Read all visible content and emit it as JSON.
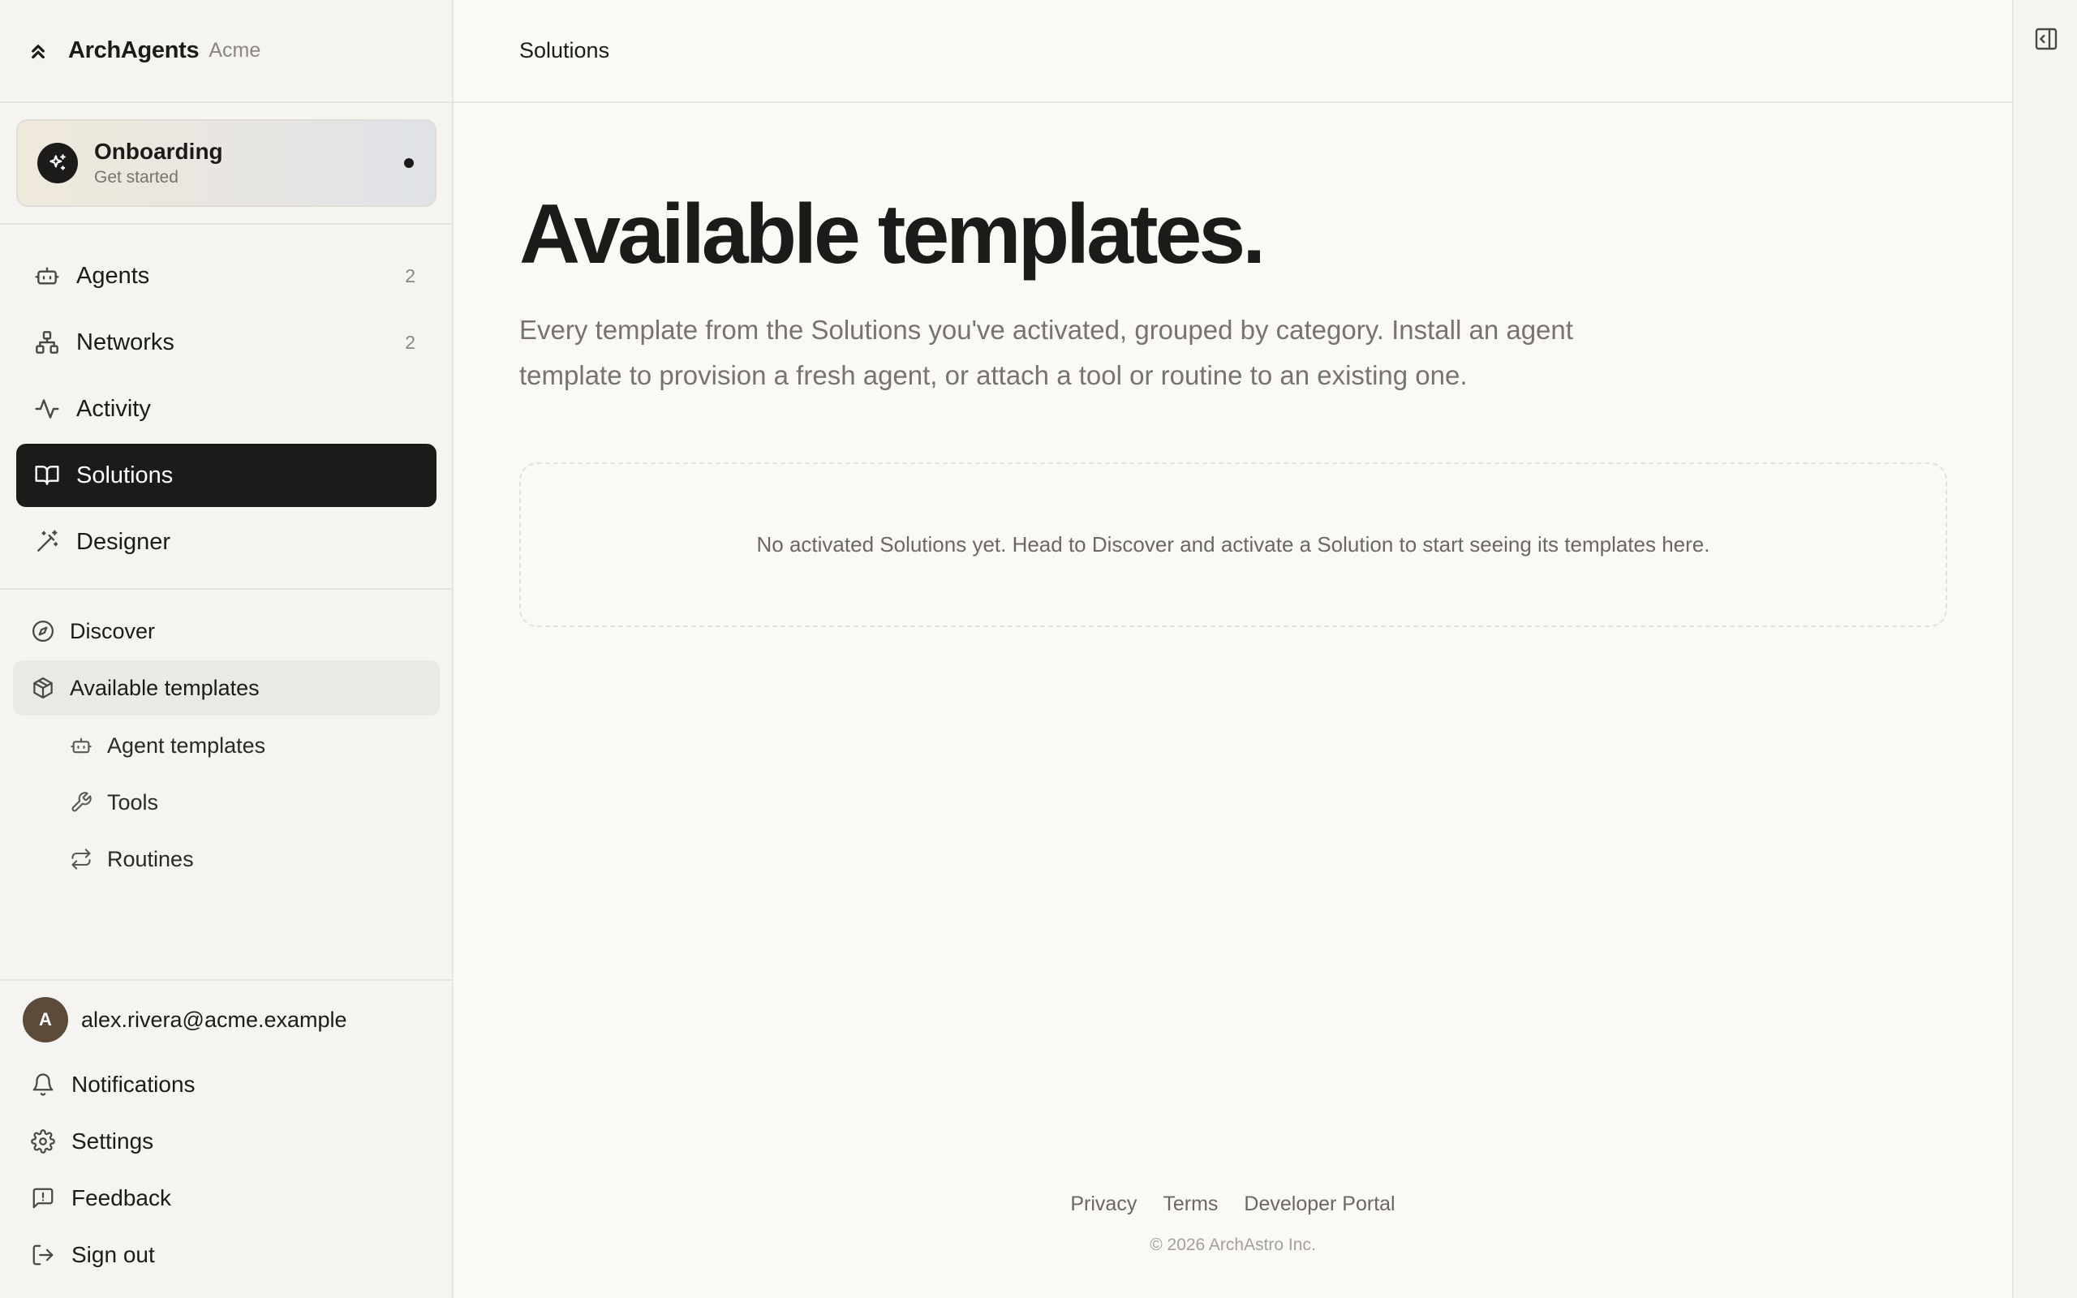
{
  "brand": {
    "name": "ArchAgents",
    "org": "Acme"
  },
  "onboarding": {
    "title": "Onboarding",
    "subtitle": "Get started"
  },
  "nav": {
    "agents": {
      "label": "Agents",
      "count": "2"
    },
    "networks": {
      "label": "Networks",
      "count": "2"
    },
    "activity": {
      "label": "Activity"
    },
    "solutions": {
      "label": "Solutions"
    },
    "designer": {
      "label": "Designer"
    }
  },
  "solutions_nav": {
    "discover": "Discover",
    "available_templates": "Available templates",
    "agent_templates": "Agent templates",
    "tools": "Tools",
    "routines": "Routines"
  },
  "user": {
    "avatar_letter": "A",
    "email": "alex.rivera@acme.example"
  },
  "footer_nav": {
    "notifications": "Notifications",
    "settings": "Settings",
    "feedback": "Feedback",
    "sign_out": "Sign out"
  },
  "header": {
    "breadcrumb": "Solutions"
  },
  "main": {
    "title": "Available templates.",
    "description": "Every template from the Solutions you've activated, grouped by category. Install an agent template to provision a fresh agent, or attach a tool or routine to an existing one.",
    "empty_message": "No activated Solutions yet. Head to Discover and activate a Solution to start seeing its templates here."
  },
  "footer": {
    "privacy": "Privacy",
    "terms": "Terms",
    "developer_portal": "Developer Portal",
    "copyright": "© 2026 ArchAstro Inc."
  },
  "colors": {
    "active_nav_bg": "#1c1b19",
    "page_bg": "#faf9f6",
    "sidebar_bg": "#f5f4f1",
    "avatar_bg": "#5c4a3a"
  }
}
